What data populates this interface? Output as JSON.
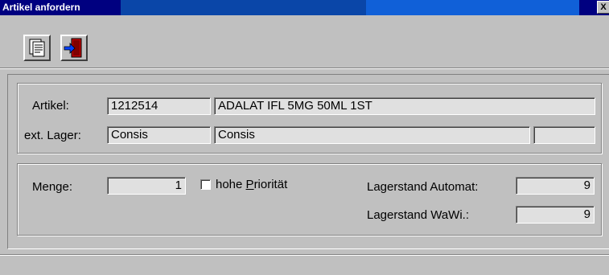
{
  "window": {
    "title": "Artikel anfordern",
    "close_label": "X"
  },
  "toolbar": {
    "buttons": [
      {
        "icon": "document-icon"
      },
      {
        "icon": "exit-door-icon"
      }
    ]
  },
  "artikel": {
    "label": "Artikel:",
    "number": "1212514",
    "description": "ADALAT IFL 5MG 50ML 1ST"
  },
  "ext_lager": {
    "label": "ext. Lager:",
    "code": "Consis",
    "name": "Consis",
    "extra": ""
  },
  "menge": {
    "label": "Menge:",
    "value": "1"
  },
  "hohe_prioritaet": {
    "label_pre": "hohe ",
    "label_accel": "P",
    "label_post": "riorität",
    "checked": false
  },
  "lagerstand_automat": {
    "label": "Lagerstand Automat:",
    "value": "9"
  },
  "lagerstand_wawi": {
    "label": "Lagerstand WaWi.:",
    "value": "9"
  }
}
